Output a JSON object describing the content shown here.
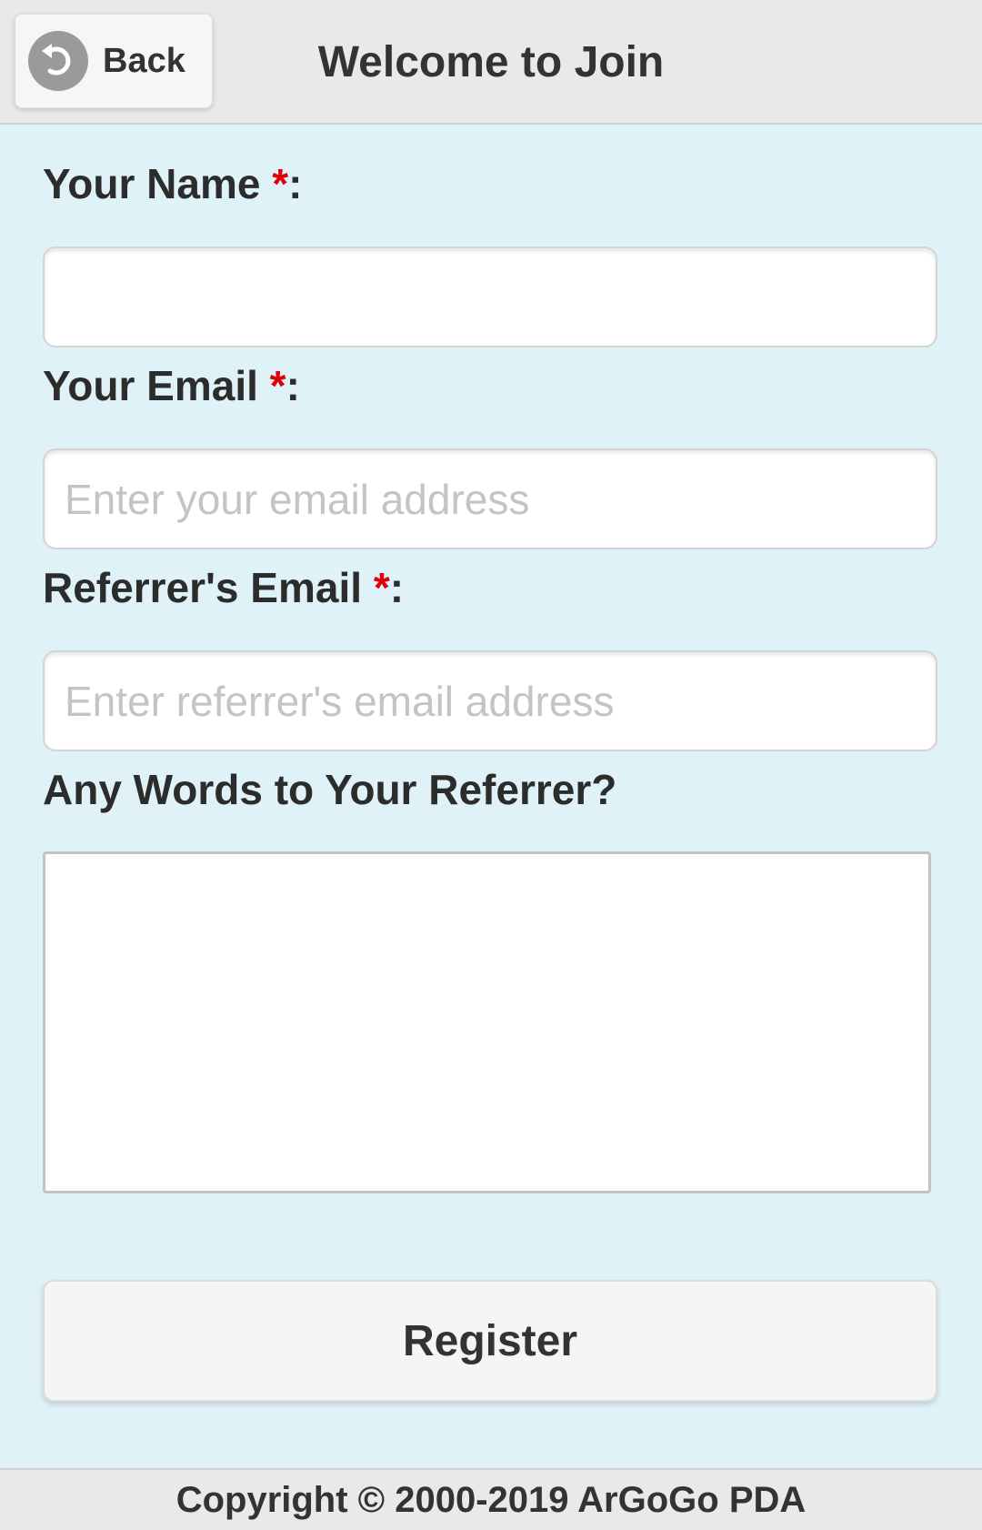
{
  "header": {
    "back_label": "Back",
    "title": "Welcome to Join"
  },
  "form": {
    "name_label": "Your Name ",
    "name_required": "*",
    "name_value": "",
    "email_label": "Your Email ",
    "email_required": "*",
    "email_placeholder": "Enter your email address",
    "referrer_label": "Referrer's Email ",
    "referrer_required": "*",
    "referrer_placeholder": "Enter referrer's email address",
    "words_label": "Any Words to Your Referrer?",
    "colon": ":",
    "register_label": "Register"
  },
  "footer": {
    "copyright": "Copyright © 2000-2019 ArGoGo PDA"
  },
  "colors": {
    "background": "#dff2f8",
    "header_bg": "#e9e9e9",
    "required": "#e0000b"
  },
  "icons": {
    "back": "back-arrow-icon"
  }
}
